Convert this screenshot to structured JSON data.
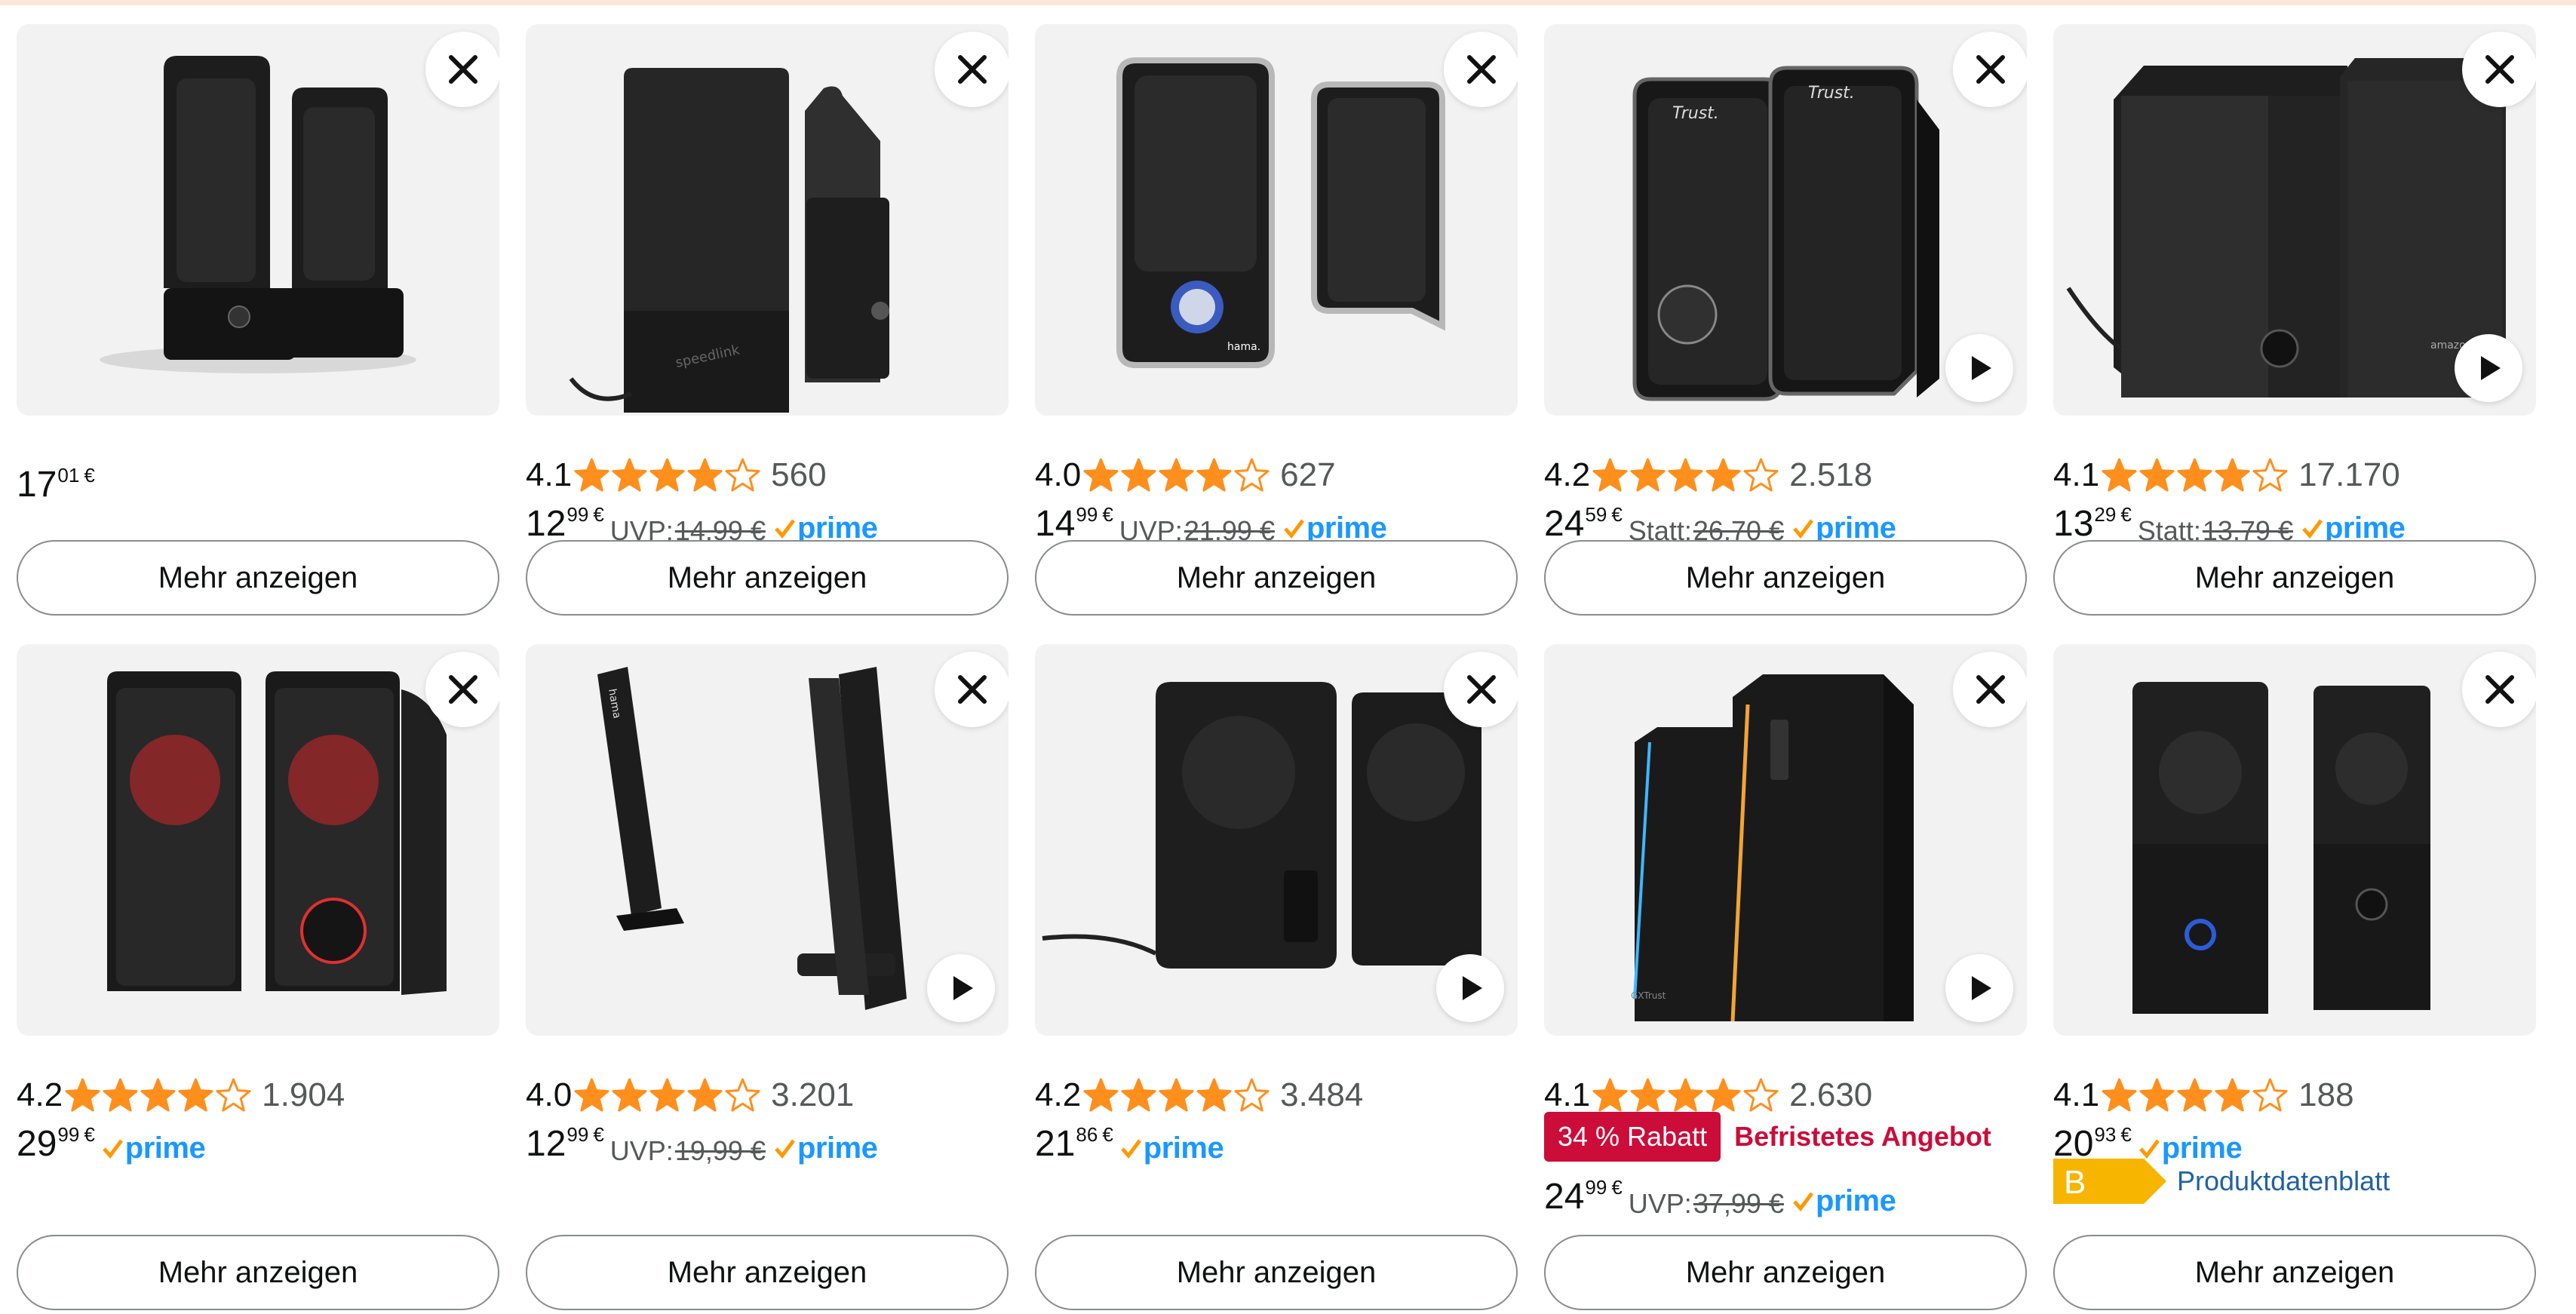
{
  "colors": {
    "star": "#ff8f1c",
    "prime": "#1a98ff",
    "deal": "#cc0c39",
    "energy_b": "#f7b500"
  },
  "row1": [
    {
      "price_whole": "17",
      "price_cents": "01",
      "currency": "€"
    },
    {
      "rating": "4.1",
      "stars": 4.1,
      "reviews": "560",
      "price_whole": "12",
      "price_cents": "99",
      "currency": "€",
      "old_label": "UVP:",
      "old_price": "14,99 €",
      "prime": "prime"
    },
    {
      "rating": "4.0",
      "stars": 4.0,
      "reviews": "627",
      "price_whole": "14",
      "price_cents": "99",
      "currency": "€",
      "old_label": "UVP:",
      "old_price": "21,99 €",
      "prime": "prime"
    },
    {
      "rating": "4.2",
      "stars": 4.2,
      "reviews": "2.518",
      "price_whole": "24",
      "price_cents": "59",
      "currency": "€",
      "old_label": "Statt:",
      "old_price": "26,70 €",
      "prime": "prime"
    },
    {
      "rating": "4.1",
      "stars": 4.1,
      "reviews": "17.170",
      "price_whole": "13",
      "price_cents": "29",
      "currency": "€",
      "old_label": "Statt:",
      "old_price": "13,79 €",
      "prime": "prime"
    }
  ],
  "row2": [
    {
      "rating": "4.2",
      "stars": 4.2,
      "reviews": "1.904",
      "price_whole": "29",
      "price_cents": "99",
      "currency": "€",
      "prime": "prime"
    },
    {
      "rating": "4.0",
      "stars": 4.0,
      "reviews": "3.201",
      "price_whole": "12",
      "price_cents": "99",
      "currency": "€",
      "old_label": "UVP:",
      "old_price": "19,99 €",
      "prime": "prime"
    },
    {
      "rating": "4.2",
      "stars": 4.2,
      "reviews": "3.484",
      "price_whole": "21",
      "price_cents": "86",
      "currency": "€",
      "prime": "prime"
    },
    {
      "rating": "4.1",
      "stars": 4.1,
      "reviews": "2.630",
      "deal_badge": "34 % Rabatt",
      "deal_text": "Befristetes Angebot",
      "price_whole": "24",
      "price_cents": "99",
      "currency": "€",
      "old_label": "UVP:",
      "old_price": "37,99 €",
      "prime": "prime"
    },
    {
      "rating": "4.1",
      "stars": 4.1,
      "reviews": "188",
      "price_whole": "20",
      "price_cents": "93",
      "currency": "€",
      "prime": "prime",
      "energy_class": "B",
      "energy_link": "Produktdatenblatt"
    }
  ],
  "more_button": "Mehr anzeigen",
  "brand_marks": {
    "trust": "Trust.",
    "hama": "hama",
    "amazon": "amazonbasics",
    "speedlink": "speedlink",
    "gxt": "GXTrust"
  }
}
